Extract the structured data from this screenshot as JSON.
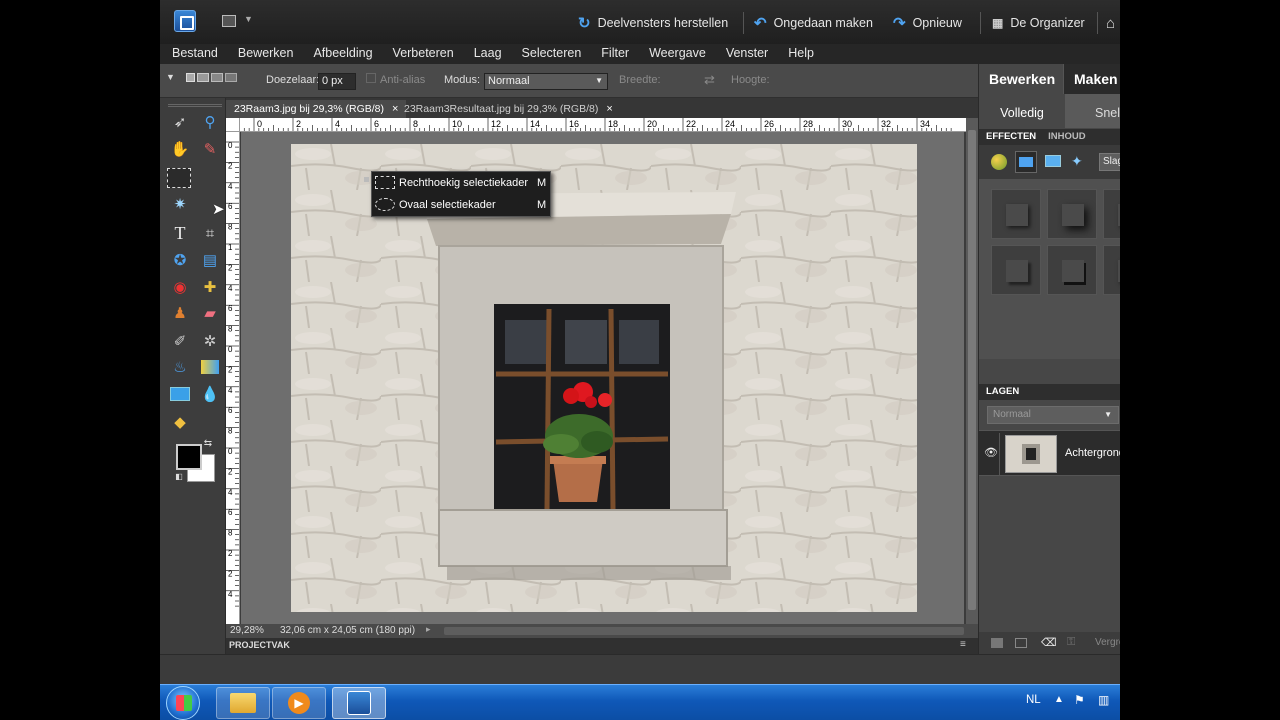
{
  "titlebar": {
    "restore_panels": "Deelvensters herstellen",
    "undo": "Ongedaan maken",
    "redo": "Opnieuw",
    "organizer": "De Organizer"
  },
  "menu": [
    "Bestand",
    "Bewerken",
    "Afbeelding",
    "Verbeteren",
    "Laag",
    "Selecteren",
    "Filter",
    "Weergave",
    "Venster",
    "Help"
  ],
  "options": {
    "feather_label": "Doezelaar:",
    "feather_value": "0 px",
    "antialias_label": "Anti-alias",
    "mode_label": "Modus:",
    "mode_value": "Normaal",
    "width_label": "Breedte:",
    "height_label": "Hoogte:"
  },
  "documents": [
    {
      "title": "23Raam3.jpg bij 29,3% (RGB/8)",
      "close": "×"
    },
    {
      "title": "23Raam3Resultaat.jpg bij 29,3% (RGB/8)",
      "close": "×"
    }
  ],
  "ruler_h": [
    "2",
    "0",
    "2",
    "4",
    "6",
    "8",
    "10",
    "12",
    "14",
    "16",
    "18",
    "20",
    "22",
    "24",
    "26",
    "28",
    "30",
    "32",
    "34"
  ],
  "ruler_v": [
    "0",
    "2",
    "4",
    "6",
    "8",
    "1",
    "2",
    "4",
    "6",
    "8",
    "0",
    "2",
    "4",
    "6",
    "8",
    "0",
    "2",
    "4",
    "6",
    "8",
    "2",
    "2",
    "4"
  ],
  "flyout": [
    {
      "label": "Rechthoekig selectiekader",
      "key": "M"
    },
    {
      "label": "Ovaal selectiekader",
      "key": "M"
    }
  ],
  "status": {
    "zoom": "29,28%",
    "info": "32,06 cm x 24,05 cm (180 ppi)"
  },
  "project_bin": "PROJECTVAK",
  "panel": {
    "tabs": [
      "Bewerken",
      "Maken"
    ],
    "subtabs": [
      "Volledig",
      "Snel"
    ],
    "effects_tabs": [
      "EFFECTEN",
      "INHOUD"
    ],
    "dropdown": "Slagschaduw",
    "layers_header": "LAGEN",
    "blend_mode": "Normaal",
    "layer_name": "Achtergrond",
    "footer_label": "Vergrendelen"
  },
  "taskbar": {
    "lang": "NL"
  }
}
